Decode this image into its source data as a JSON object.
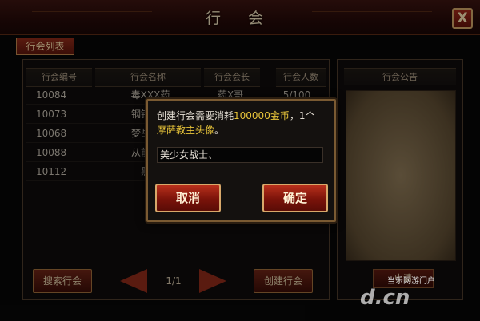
{
  "title": "行 会",
  "close_label": "X",
  "tab": "行会列表",
  "columns": [
    "行会编号",
    "行会名称",
    "行会会长",
    "行会人数"
  ],
  "rows": [
    {
      "id": "10084",
      "name": "毒XXX药",
      "leader": "药X哥",
      "count": "5/100"
    },
    {
      "id": "10073",
      "name": "钢铁丶炮",
      "leader": "",
      "count": ""
    },
    {
      "id": "10068",
      "name": "梦战杀戮",
      "leader": "",
      "count": ""
    },
    {
      "id": "10088",
      "name": "从前有座",
      "leader": "",
      "count": ""
    },
    {
      "id": "10112",
      "name": "黑帮",
      "leader": "",
      "count": ""
    }
  ],
  "announcement_title": "行会公告",
  "announcement_button": "申请",
  "search_button": "搜索行会",
  "create_button": "创建行会",
  "page": "1/1",
  "modal": {
    "msg_part1": "创建行会需要消耗",
    "msg_gold": "100000金币",
    "msg_part2": "，1个",
    "msg_item": "摩萨教主头像",
    "msg_end": "。",
    "input_value": "美少女战士、",
    "cancel": "取消",
    "confirm": "确定"
  },
  "watermark": {
    "line1": "当乐网游门户",
    "line2": "d.cn"
  },
  "colors": {
    "accent_red": "#8a2a18",
    "gold_text": "#e8c43a",
    "parchment": "#7a6548"
  }
}
